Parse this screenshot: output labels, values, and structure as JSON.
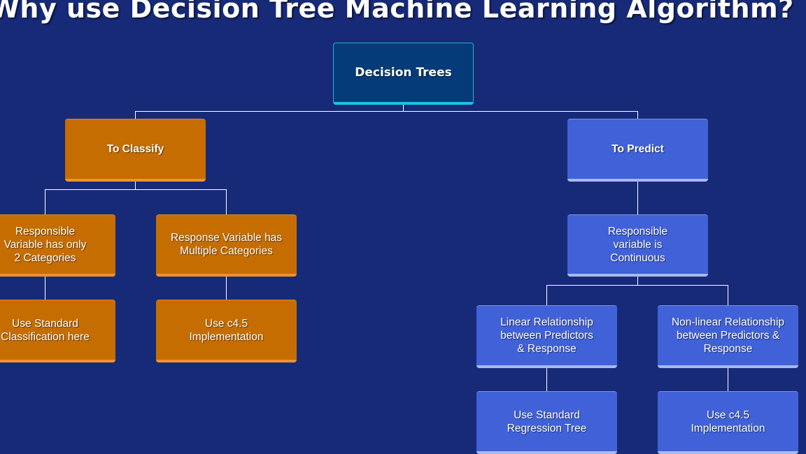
{
  "slide": {
    "title": "Why use Decision Tree Machine Learning Algorithm?",
    "colors": {
      "background": "#172a78",
      "root_fill": "#053b78",
      "root_accent": "#1cc3dc",
      "classify_fill": "#c56d00",
      "classify_accent": "#f0922a",
      "predict_fill": "#4061d7",
      "predict_accent": "#a9b9f2",
      "connector": "#ffffff"
    }
  },
  "tree": {
    "root": {
      "label": "Decision Trees"
    },
    "classify": {
      "label": "To Classify",
      "children": [
        {
          "label": "Responsible\nVariable has only\n2 Categories",
          "leaf": "Use Standard\nClassification here"
        },
        {
          "label": "Response Variable has\nMultiple Categories",
          "leaf": "Use c4.5\nImplementation"
        }
      ]
    },
    "predict": {
      "label": "To Predict",
      "child": {
        "label": "Responsible\nvariable is\nContinuous"
      },
      "children": [
        {
          "label": "Linear Relationship\nbetween Predictors\n& Response",
          "leaf": "Use Standard\nRegression Tree"
        },
        {
          "label": "Non-linear Relationship\nbetween Predictors &\nResponse",
          "leaf": "Use c4.5\nImplementation"
        }
      ]
    }
  }
}
